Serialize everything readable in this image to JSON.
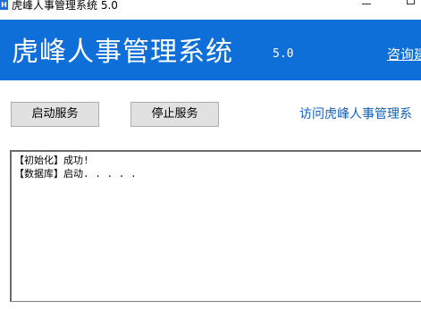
{
  "window": {
    "title": "虎峰人事管理系统 5.0"
  },
  "header": {
    "title": "虎峰人事管理系统",
    "version": "5.0",
    "link_label": "咨询建"
  },
  "toolbar": {
    "start_label": "启动服务",
    "stop_label": "停止服务",
    "visit_label": "访问虎峰人事管理系"
  },
  "log": {
    "lines": [
      "【初始化】成功!",
      "【数据库】启动. . . . ."
    ]
  },
  "colors": {
    "header_bg": "#0e6fd8",
    "link_blue": "#1060b8",
    "button_bg": "#e1e1e1"
  }
}
